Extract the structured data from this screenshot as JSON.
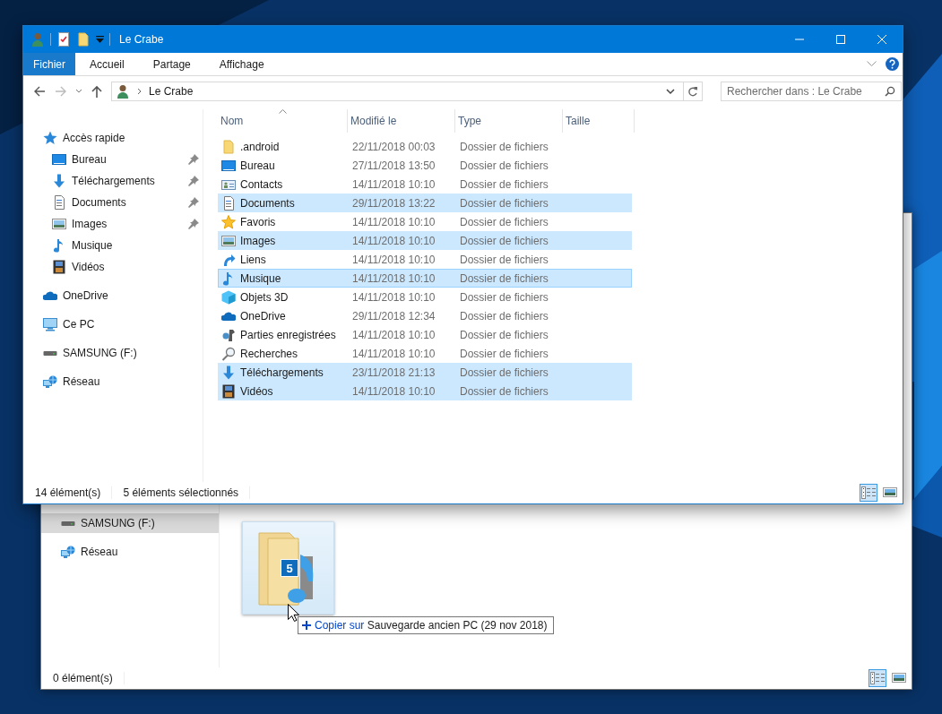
{
  "back_window": {
    "nav_items": [
      {
        "label": "SAMSUNG (F:)",
        "kind": "drive",
        "selected": true
      },
      {
        "label": "Réseau",
        "kind": "network",
        "selected": false
      }
    ],
    "status_bar": {
      "item_count": "0 élément(s)"
    },
    "view_buttons": [
      {
        "kind": "details",
        "selected": true
      },
      {
        "kind": "large-icons",
        "selected": false
      }
    ]
  },
  "front_window": {
    "title": "Le Crabe",
    "ribbon_tabs": [
      {
        "label": "Fichier",
        "kind": "file"
      },
      {
        "label": "Accueil",
        "kind": "tab"
      },
      {
        "label": "Partage",
        "kind": "tab"
      },
      {
        "label": "Affichage",
        "kind": "tab"
      }
    ],
    "address": {
      "location": "Le Crabe"
    },
    "search": {
      "placeholder": "Rechercher dans : Le Crabe"
    },
    "nav": [
      {
        "label": "Accès rapide",
        "kind": "quick",
        "children": [
          {
            "label": "Bureau",
            "kind": "desktop",
            "pinned": true
          },
          {
            "label": "Téléchargements",
            "kind": "download",
            "pinned": true
          },
          {
            "label": "Documents",
            "kind": "documents",
            "pinned": true
          },
          {
            "label": "Images",
            "kind": "images",
            "pinned": true
          },
          {
            "label": "Musique",
            "kind": "music",
            "pinned": false
          },
          {
            "label": "Vidéos",
            "kind": "video",
            "pinned": false
          }
        ]
      },
      {
        "label": "OneDrive",
        "kind": "cloud"
      },
      {
        "label": "Ce PC",
        "kind": "pc"
      },
      {
        "label": "SAMSUNG (F:)",
        "kind": "drive"
      },
      {
        "label": "Réseau",
        "kind": "network"
      }
    ],
    "columns": [
      {
        "label": "Nom",
        "sorted": true
      },
      {
        "label": "Modifié le",
        "sorted": false
      },
      {
        "label": "Type",
        "sorted": false
      },
      {
        "label": "Taille",
        "sorted": false
      }
    ],
    "rows": [
      {
        "name": ".android",
        "kind": "folder",
        "modified": "22/11/2018 00:03",
        "type": "Dossier de fichiers",
        "selected": false,
        "focused": false
      },
      {
        "name": "Bureau",
        "kind": "desktop",
        "modified": "27/11/2018 13:50",
        "type": "Dossier de fichiers",
        "selected": false,
        "focused": false
      },
      {
        "name": "Contacts",
        "kind": "contacts",
        "modified": "14/11/2018 10:10",
        "type": "Dossier de fichiers",
        "selected": false,
        "focused": false
      },
      {
        "name": "Documents",
        "kind": "documents",
        "modified": "29/11/2018 13:22",
        "type": "Dossier de fichiers",
        "selected": true,
        "focused": false
      },
      {
        "name": "Favoris",
        "kind": "star",
        "modified": "14/11/2018 10:10",
        "type": "Dossier de fichiers",
        "selected": false,
        "focused": false
      },
      {
        "name": "Images",
        "kind": "images",
        "modified": "14/11/2018 10:10",
        "type": "Dossier de fichiers",
        "selected": true,
        "focused": false
      },
      {
        "name": "Liens",
        "kind": "link",
        "modified": "14/11/2018 10:10",
        "type": "Dossier de fichiers",
        "selected": false,
        "focused": false
      },
      {
        "name": "Musique",
        "kind": "music",
        "modified": "14/11/2018 10:10",
        "type": "Dossier de fichiers",
        "selected": true,
        "focused": true
      },
      {
        "name": "Objets 3D",
        "kind": "cube",
        "modified": "14/11/2018 10:10",
        "type": "Dossier de fichiers",
        "selected": false,
        "focused": false
      },
      {
        "name": "OneDrive",
        "kind": "cloud",
        "modified": "29/11/2018 12:34",
        "type": "Dossier de fichiers",
        "selected": false,
        "focused": false
      },
      {
        "name": "Parties enregistrées",
        "kind": "game",
        "modified": "14/11/2018 10:10",
        "type": "Dossier de fichiers",
        "selected": false,
        "focused": false
      },
      {
        "name": "Recherches",
        "kind": "search",
        "modified": "14/11/2018 10:10",
        "type": "Dossier de fichiers",
        "selected": false,
        "focused": false
      },
      {
        "name": "Téléchargements",
        "kind": "download",
        "modified": "23/11/2018 21:13",
        "type": "Dossier de fichiers",
        "selected": true,
        "focused": false
      },
      {
        "name": "Vidéos",
        "kind": "video",
        "modified": "14/11/2018 10:10",
        "type": "Dossier de fichiers",
        "selected": true,
        "focused": false
      }
    ],
    "status_bar": {
      "item_count": "14 élément(s)",
      "selection": "5 éléments sélectionnés"
    },
    "view_buttons": [
      {
        "kind": "details",
        "selected": true
      },
      {
        "kind": "large-icons",
        "selected": false
      }
    ]
  },
  "drag": {
    "badge": "5",
    "tooltip": {
      "action": "Copier sur",
      "target": "Sauvegarde ancien PC (29 nov 2018)"
    }
  }
}
